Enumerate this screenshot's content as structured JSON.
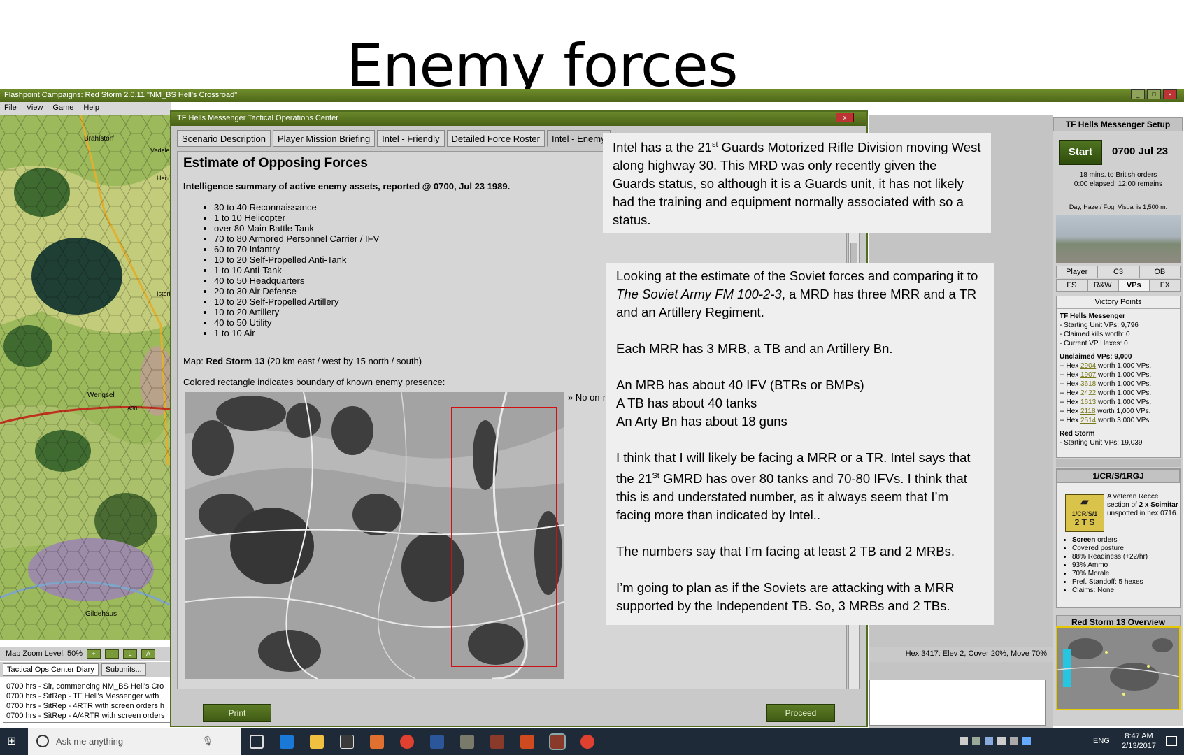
{
  "slide": {
    "title": "Enemy forces"
  },
  "app": {
    "title": "Flashpoint Campaigns: Red Storm  2.0.11  \"NM_BS Hell's Crossroad\"",
    "menu": [
      "File",
      "View",
      "Game",
      "Help"
    ],
    "map_zoom": "Map Zoom Level: 50%",
    "zoom_buttons": [
      "+",
      "-",
      "L",
      "A"
    ],
    "diary_tabs": [
      "Tactical Ops Center Diary",
      "Subunits..."
    ],
    "diary_lines": [
      "0700 hrs - Sir, commencing NM_BS Hell's Cro",
      "0700 hrs - SitRep - TF Hell's Messenger with",
      "0700 hrs - SitRep - 4RTR with screen orders h",
      "0700 hrs - SitRep - A/4RTR with screen orders"
    ],
    "map_places": [
      "Brahlstorf",
      "Vedele",
      "Hei",
      "Istorn",
      "Wengsel",
      "Gildehaus",
      "A30"
    ],
    "status_line": "Hex 3417: Elev 2, Cover 20%, Move 70%"
  },
  "toc": {
    "title": "TF Hells Messenger Tactical Operations Center",
    "close_label": "x",
    "tabs": [
      "Scenario Description",
      "Player Mission Briefing",
      "Intel - Friendly",
      "Detailed Force Roster",
      "Intel - Enemy"
    ],
    "active_tab": "Intel - Enemy",
    "heading": "Estimate of Opposing Forces",
    "summary": "Intelligence summary of active enemy assets, reported @ 0700, Jul 23 1989.",
    "forces": [
      "30 to 40 Reconnaissance",
      "1 to 10 Helicopter",
      "over 80 Main Battle Tank",
      "70 to 80 Armored Personnel Carrier / IFV",
      "60 to 70 Infantry",
      "10 to 20 Self-Propelled Anti-Tank",
      "1 to 10 Anti-Tank",
      "40 to 50 Headquarters",
      "20 to 30 Air Defense",
      "10 to 20 Self-Propelled Artillery",
      "10 to 20 Artillery",
      "40 to 50 Utility",
      "1 to 10 Air"
    ],
    "map_prefix": "Map: ",
    "map_name": "Red Storm 13",
    "map_suffix": " (20 km east / west by 15 north / south)",
    "rect_note": "Colored rectangle indicates boundary of known enemy presence:",
    "no_onmap": "» No on-m",
    "print_label": "Print",
    "proceed_label": "Proceed"
  },
  "setup": {
    "title": "TF Hells Messenger Setup",
    "start_label": "Start",
    "time": "0700 Jul 23",
    "orders_line1": "18 mins. to British orders",
    "orders_line2": "0:00 elapsed, 12:00 remains",
    "weather": "Day, Haze / Fog, Visual is 1,500 m.",
    "tabs_row1": [
      "Player",
      "C3",
      "OB"
    ],
    "tabs_row2": [
      "FS",
      "R&W",
      "VPs",
      "FX"
    ],
    "active_tab": "VPs",
    "vp": {
      "heading": "Victory Points",
      "side1": "TF Hells Messenger",
      "side1_lines": [
        "- Starting Unit VPs: 9,796",
        "- Claimed kills worth: 0",
        "- Current VP Hexes: 0"
      ],
      "unclaimed": "Unclaimed VPs: 9,000",
      "hexes": [
        {
          "hex": "2904",
          "worth": "1,000"
        },
        {
          "hex": "1907",
          "worth": "1,000"
        },
        {
          "hex": "3618",
          "worth": "1,000"
        },
        {
          "hex": "2422",
          "worth": "1,000"
        },
        {
          "hex": "1613",
          "worth": "1,000"
        },
        {
          "hex": "2118",
          "worth": "1,000"
        },
        {
          "hex": "2514",
          "worth": "3,000"
        }
      ],
      "hex_prefix": "-- Hex ",
      "worth_prefix": " worth ",
      "worth_suffix": " VPs.",
      "side2": "Red Storm",
      "side2_line": "- Starting Unit VPs: 19,039"
    }
  },
  "unit": {
    "header": "1/CR/S/1RGJ",
    "badge_top": "1/CR/S/1",
    "badge_bottom": "2 T S",
    "desc_pre": "A veteran Recce section of ",
    "desc_bold": "2 x Scimitar",
    "desc_post": " unspotted in hex 0716.",
    "orders_bold": "Screen",
    "orders_rest": " orders",
    "stats": [
      "Covered posture",
      "88% Readiness (+22/hr)",
      "93% Ammo",
      "70% Morale",
      "Pref. Standoff: 5 hexes",
      "Claims: None"
    ]
  },
  "overview": {
    "title": "Red Storm 13 Overview"
  },
  "callout1": {
    "pre": "Intel has a the 21",
    "sup": "st",
    "post": " Guards Motorized Rifle Division moving West along highway 30.  This MRD was only recently given the Guards status, so although it is a Guards unit, it has not likely had the training and equipment normally associated with so a status."
  },
  "callout2": {
    "p1_pre": "Looking at the estimate of the Soviet forces and comparing it to ",
    "p1_italic": "The Soviet Army  FM 100-2-3",
    "p1_post": ", a MRD has three MRR and a TR and an Artillery Regiment.",
    "p2": "Each MRR has 3 MRB,  a TB and an Artillery Bn.",
    "p3a": "An MRB has about 40 IFV (BTRs or BMPs)",
    "p3b": "A TB has about 40 tanks",
    "p3c": "An Arty Bn has about 18 guns",
    "p4_pre": "I think that I will likely be facing a MRR or a TR.  Intel says that the 21",
    "p4_sup": "St",
    "p4_post": " GMRD has over 80 tanks and 70-80 IFVs.  I think that this is and understated number, as it always seem that I’m facing more than indicated by Intel..",
    "p5": "The numbers say that I’m facing at least 2 TB and 2 MRBs.",
    "p6": "I’m going to plan as if the Soviets are attacking with a MRR supported by the Independent TB.   So, 3 MRBs and 2 TBs."
  },
  "taskbar": {
    "search": "Ask me anything",
    "lang": "ENG",
    "time": "8:47 AM",
    "date": "2/13/2017"
  },
  "colors": {
    "app_green": "#5a7a1f",
    "enemy_rect": "#d01010",
    "overview_border": "#e5c800"
  }
}
